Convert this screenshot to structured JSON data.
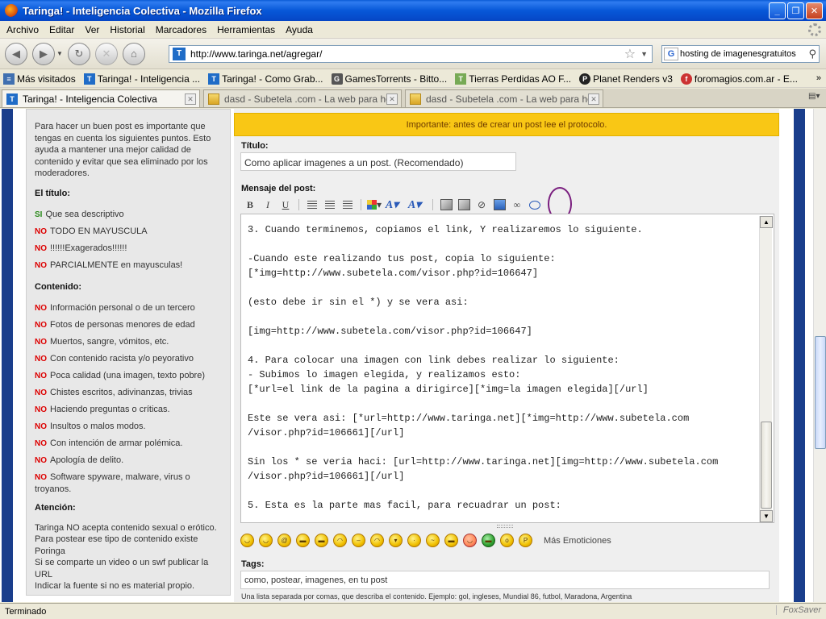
{
  "window": {
    "title": "Taringa! - Inteligencia Colectiva - Mozilla Firefox"
  },
  "menu": [
    "Archivo",
    "Editar",
    "Ver",
    "Historial",
    "Marcadores",
    "Herramientas",
    "Ayuda"
  ],
  "nav": {
    "url": "http://www.taringa.net/agregar/",
    "search_value": "hosting de imagenesgratuitos"
  },
  "bookmarks": [
    {
      "label": "Más visitados",
      "icon": "most-visited-icon",
      "kind": "mv"
    },
    {
      "label": "Taringa! - Inteligencia ...",
      "icon": "taringa-icon",
      "kind": "t"
    },
    {
      "label": "Taringa! - Como Grab...",
      "icon": "taringa-icon",
      "kind": "t"
    },
    {
      "label": "GamesTorrents - Bitto...",
      "icon": "gamestorrents-icon",
      "kind": "gt"
    },
    {
      "label": "Tierras Perdidas AO F...",
      "icon": "tierras-perdidas-icon",
      "kind": "tp"
    },
    {
      "label": "Planet Renders v3",
      "icon": "planet-renders-icon",
      "kind": "pr"
    },
    {
      "label": "foromagios.com.ar - E...",
      "icon": "foromagios-icon",
      "kind": "fm"
    }
  ],
  "tabs": [
    {
      "label": "Taringa! - Inteligencia Colectiva",
      "active": true
    },
    {
      "label": "dasd - Subetela .com - La web para hosp...",
      "active": false
    },
    {
      "label": "dasd - Subetela .com - La web para hosp...",
      "active": false
    }
  ],
  "sidebar": {
    "intro": "Para hacer un buen post es importante que tengas en cuenta los siguientes puntos. Esto ayuda a mantener una mejor calidad de contenido y evitar que sea eliminado por los moderadores.",
    "title_heading": "El título:",
    "title_items": [
      {
        "tag": "SI",
        "text": "Que sea descriptivo"
      },
      {
        "tag": "NO",
        "text": "TODO EN MAYUSCULA"
      },
      {
        "tag": "NO",
        "text": "!!!!!!Exagerados!!!!!!"
      },
      {
        "tag": "NO",
        "text": "PARCIALMENTE en mayusculas!"
      }
    ],
    "content_heading": "Contenido:",
    "content_items": [
      {
        "tag": "NO",
        "text": "Información personal o de un tercero"
      },
      {
        "tag": "NO",
        "text": "Fotos de personas menores de edad"
      },
      {
        "tag": "NO",
        "text": "Muertos, sangre, vómitos, etc."
      },
      {
        "tag": "NO",
        "text": "Con contenido racista y/o peyorativo"
      },
      {
        "tag": "NO",
        "text": "Poca calidad (una imagen, texto pobre)"
      },
      {
        "tag": "NO",
        "text": "Chistes escritos, adivinanzas, trivias"
      },
      {
        "tag": "NO",
        "text": "Haciendo preguntas o críticas."
      },
      {
        "tag": "NO",
        "text": "Insultos o malos modos."
      },
      {
        "tag": "NO",
        "text": "Con intención de armar polémica."
      },
      {
        "tag": "NO",
        "text": "Apología de delito."
      },
      {
        "tag": "NO",
        "text": "Software spyware, malware, virus o troyanos."
      }
    ],
    "attention_heading": "Atención:",
    "attention_1": "Taringa NO acepta contenido sexual o erótico.",
    "attention_2": "Para postear ese tipo de contenido existe",
    "attention_link": "Poringa",
    "attention_3": "Si se comparte un video o un swf publicar la URL",
    "attention_4": "Indicar la fuente si no es material propio."
  },
  "form": {
    "notice": "Importante: antes de crear un post lee el protocolo.",
    "title_label": "Título:",
    "title_value": "Como aplicar imagenes a un post. (Recomendado)",
    "message_label": "Mensaje del post:",
    "message_text": "3. Cuando terminemos, copiamos el link, Y realizaremos lo siguiente.\n\n-Cuando este realizando tus post, copia lo siguiente:\n[*img=http://www.subetela.com/visor.php?id=106647]\n\n(esto debe ir sin el *) y se vera asi:\n\n[img=http://www.subetela.com/visor.php?id=106647]\n\n4. Para colocar una imagen con link debes realizar lo siguiente:\n- Subimos lo imagen elegida, y realizamos esto:\n[*url=el link de la pagina a dirigirce][*img=la imagen elegida][/url]\n\nEste se vera asi: [*url=http://www.taringa.net][*img=http://www.subetela.com\n/visor.php?id=106661][/url]\n\nSin los * se veria haci: [url=http://www.taringa.net][img=http://www.subetela.com\n/visor.php?id=106661][/url]\n\n5. Esta es la parte mas facil, para recuadrar un post:",
    "more_emoticons": "Más Emoticiones",
    "tags_label": "Tags:",
    "tags_value": "como, postear, imagenes, en tu post",
    "tags_help": "Una lista separada por comas, que describa el contenido. Ejemplo: gol, ingleses, Mundial 86, futbol, Maradona, Argentina"
  },
  "status": {
    "text": "Terminado",
    "addon": "FoxSaver"
  }
}
